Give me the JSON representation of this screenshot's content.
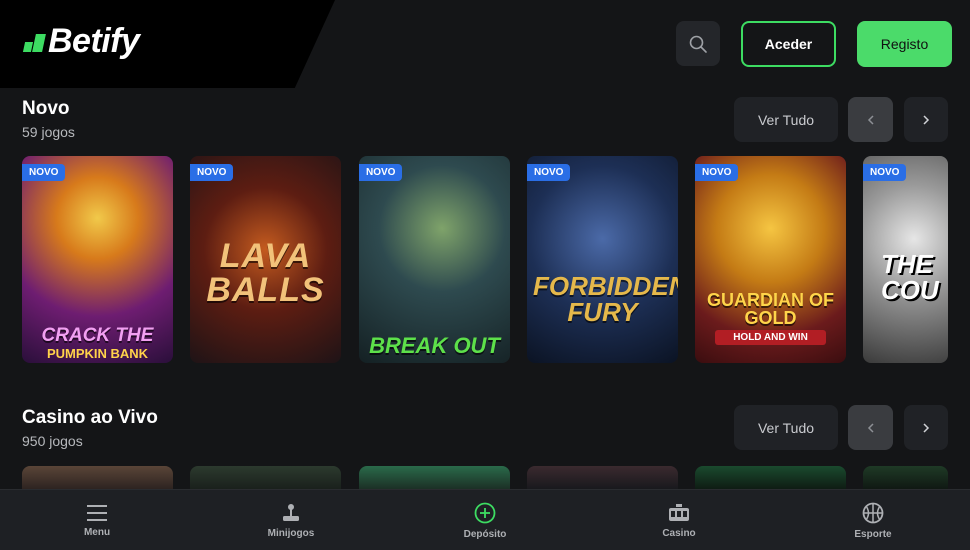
{
  "brand": {
    "name": "Betify",
    "accent": "#3ddc62"
  },
  "header": {
    "search_icon": "search-icon",
    "login_label": "Aceder",
    "register_label": "Registo"
  },
  "sections": [
    {
      "title": "Novo",
      "count": "59 jogos",
      "view_all": "Ver Tudo",
      "games": [
        {
          "badge": "NOVO",
          "title": "CRACK THE",
          "subtitle": "PUMPKIN BANK"
        },
        {
          "badge": "NOVO",
          "title": "LAVA BALLS"
        },
        {
          "badge": "NOVO",
          "title": "BREAK OUT"
        },
        {
          "badge": "NOVO",
          "title": "FORBIDDEN FURY"
        },
        {
          "badge": "NOVO",
          "title": "GUARDIAN OF GOLD",
          "subtitle": "HOLD AND WIN"
        },
        {
          "badge": "NOVO",
          "title": "THE COU"
        }
      ]
    },
    {
      "title": "Casino ao Vivo",
      "count": "950 jogos",
      "view_all": "Ver Tudo"
    }
  ],
  "bottom_nav": [
    {
      "label": "Menu",
      "icon": "menu-icon"
    },
    {
      "label": "Minijogos",
      "icon": "joystick-icon"
    },
    {
      "label": "Depósito",
      "icon": "plus-circle-icon"
    },
    {
      "label": "Casino",
      "icon": "slot-machine-icon"
    },
    {
      "label": "Esporte",
      "icon": "basketball-icon"
    }
  ]
}
